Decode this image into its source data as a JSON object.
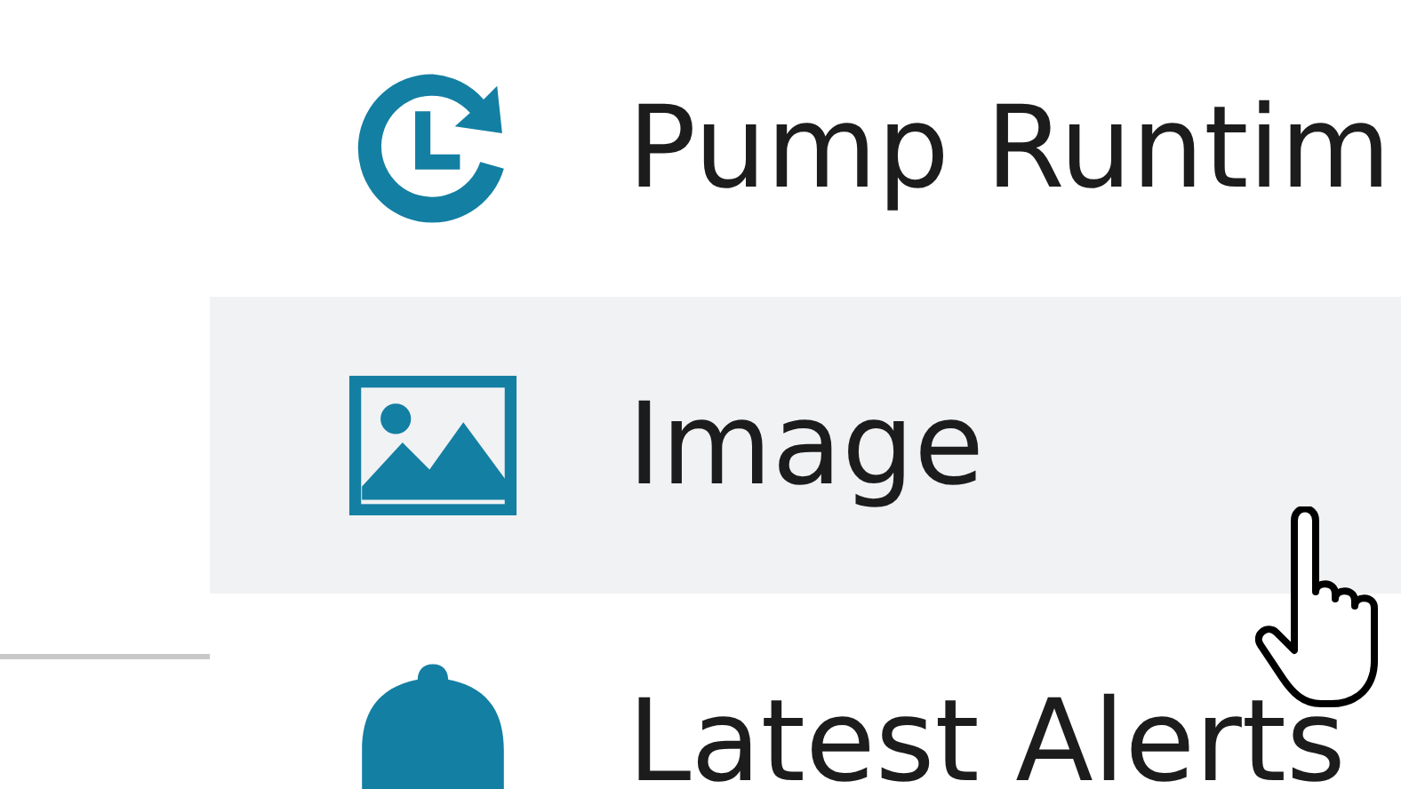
{
  "menu": {
    "items": [
      {
        "kind": "clock",
        "label": "Pump Runtim",
        "selected": false
      },
      {
        "kind": "image",
        "label": "Image",
        "selected": true
      },
      {
        "kind": "bell",
        "label": "Latest Alerts",
        "selected": false
      }
    ]
  }
}
